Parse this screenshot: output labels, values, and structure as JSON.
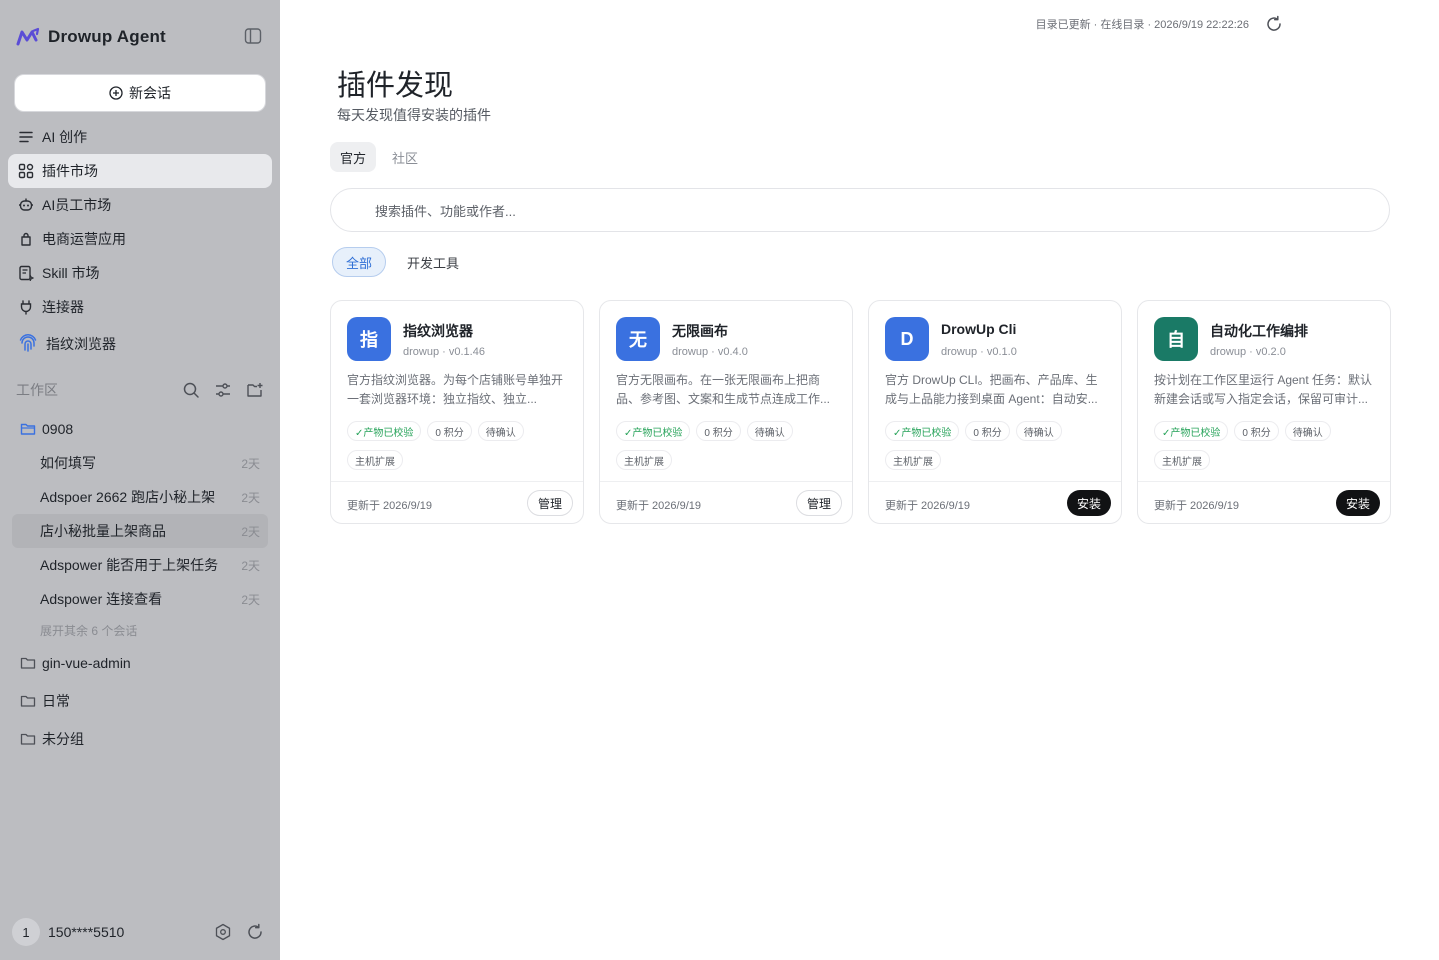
{
  "app": {
    "name": "Drowup Agent",
    "brand_color": "#5b4dd6"
  },
  "sidebar": {
    "new_chat": "新会话",
    "nav": [
      {
        "label": "AI 创作",
        "icon": "list-icon"
      },
      {
        "label": "插件市场",
        "icon": "grid-icon",
        "active": true
      },
      {
        "label": "AI员工市场",
        "icon": "robot-icon"
      },
      {
        "label": "电商运营应用",
        "icon": "bag-icon"
      },
      {
        "label": "Skill 市场",
        "icon": "skill-icon"
      },
      {
        "label": "连接器",
        "icon": "plug-icon"
      },
      {
        "label": "指纹浏览器",
        "icon": "fingerprint-icon"
      }
    ],
    "workspace_label": "工作区",
    "folders": [
      {
        "name": "0908",
        "open": true,
        "conversations": [
          {
            "title": "如何填写",
            "age": "2天"
          },
          {
            "title": "Adspoer 2662 跑店小秘上架",
            "age": "2天"
          },
          {
            "title": "店小秘批量上架商品",
            "age": "2天",
            "active": true
          },
          {
            "title": "Adspower 能否用于上架任务",
            "age": "2天"
          },
          {
            "title": "Adspower 连接查看",
            "age": "2天"
          }
        ],
        "expand_label": "展开其余 6 个会话"
      },
      {
        "name": "gin-vue-admin"
      },
      {
        "name": "日常"
      },
      {
        "name": "未分组"
      }
    ],
    "user": {
      "avatar": "1",
      "phone": "150****5510"
    }
  },
  "main": {
    "status": "目录已更新 · 在线目录 · 2026/9/19 22:22:26",
    "title": "插件发现",
    "subtitle": "每天发现值得安装的插件",
    "tabs": [
      "官方",
      "社区"
    ],
    "search_placeholder": "搜索插件、功能或作者...",
    "chips": [
      "全部",
      "开发工具"
    ],
    "cards": [
      {
        "icon_text": "指",
        "icon_color": "#3a71e0",
        "name": "指纹浏览器",
        "meta": "drowup · v0.1.46",
        "desc": "官方指纹浏览器。为每个店铺账号单独开一套浏览器环境：独立指纹、独立...",
        "tags": [
          "✓产物已校验",
          "0 积分",
          "待确认"
        ],
        "tag2": "主机扩展",
        "updated": "更新于 2026/9/19",
        "action": "管理",
        "action_type": "manage"
      },
      {
        "icon_text": "无",
        "icon_color": "#3a71e0",
        "name": "无限画布",
        "meta": "drowup · v0.4.0",
        "desc": "官方无限画布。在一张无限画布上把商品、参考图、文案和生成节点连成工作...",
        "tags": [
          "✓产物已校验",
          "0 积分",
          "待确认"
        ],
        "tag2": "主机扩展",
        "updated": "更新于 2026/9/19",
        "action": "管理",
        "action_type": "manage"
      },
      {
        "icon_text": "D",
        "icon_color": "#3a71e0",
        "name": "DrowUp Cli",
        "meta": "drowup · v0.1.0",
        "desc": "官方 DrowUp CLI。把画布、产品库、生成与上品能力接到桌面 Agent：自动安...",
        "tags": [
          "✓产物已校验",
          "0 积分",
          "待确认"
        ],
        "tag2": "主机扩展",
        "updated": "更新于 2026/9/19",
        "action": "安装",
        "action_type": "install"
      },
      {
        "icon_text": "自",
        "icon_color": "#1a7a66",
        "name": "自动化工作编排",
        "meta": "drowup · v0.2.0",
        "desc": "按计划在工作区里运行 Agent 任务：默认新建会话或写入指定会话，保留可审计...",
        "tags": [
          "✓产物已校验",
          "0 积分",
          "待确认"
        ],
        "tag2": "主机扩展",
        "updated": "更新于 2026/9/19",
        "action": "安装",
        "action_type": "install"
      }
    ]
  }
}
